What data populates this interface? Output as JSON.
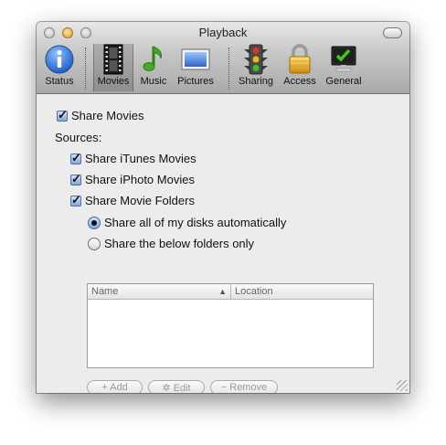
{
  "window": {
    "title": "Playback"
  },
  "toolbar": {
    "items": [
      {
        "label": "Status",
        "icon": "info-icon"
      },
      {
        "label": "Movies",
        "icon": "film-icon",
        "selected": true
      },
      {
        "label": "Music",
        "icon": "music-note-icon"
      },
      {
        "label": "Pictures",
        "icon": "picture-icon"
      },
      {
        "label": "Sharing",
        "icon": "traffic-light-icon"
      },
      {
        "label": "Access",
        "icon": "padlock-icon"
      },
      {
        "label": "General",
        "icon": "monitor-check-icon"
      }
    ]
  },
  "options": {
    "share_movies": {
      "label": "Share Movies",
      "checked": true
    },
    "sources_label": "Sources:",
    "sources": [
      {
        "label": "Share iTunes Movies",
        "checked": true
      },
      {
        "label": "Share iPhoto Movies",
        "checked": true
      },
      {
        "label": "Share Movie Folders",
        "checked": true
      }
    ],
    "folder_mode": [
      {
        "label": "Share all of my disks automatically",
        "selected": true
      },
      {
        "label": "Share the below folders only",
        "selected": false
      }
    ]
  },
  "folders_table": {
    "columns": [
      "Name",
      "Location"
    ],
    "sort_indicator": "▲",
    "rows": []
  },
  "buttons": {
    "add": "+ Add",
    "edit": "✲ Edit",
    "remove": "− Remove"
  },
  "colors": {
    "accent": "#3b73c9",
    "window_bg": "#ececec"
  }
}
